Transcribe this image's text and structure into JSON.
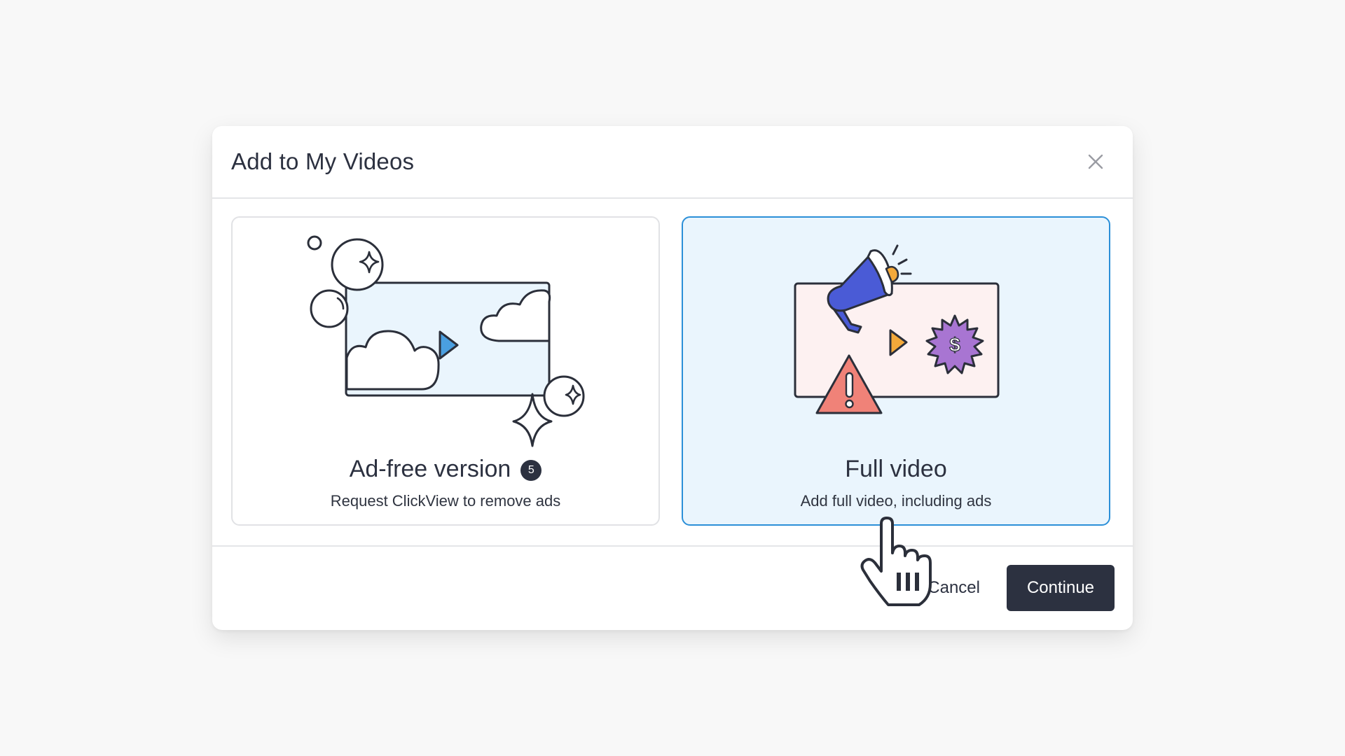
{
  "modal": {
    "title": "Add to My Videos",
    "close_icon": "close-icon"
  },
  "options": [
    {
      "id": "ad-free",
      "title": "Ad-free version",
      "badge": "5",
      "description": "Request ClickView to remove ads",
      "selected": false,
      "icon": "video-clouds-sparkles-icon"
    },
    {
      "id": "full",
      "title": "Full video",
      "description": "Add full video, including ads",
      "selected": true,
      "icon": "video-megaphone-ads-icon"
    }
  ],
  "footer": {
    "cancel_label": "Cancel",
    "continue_label": "Continue"
  },
  "colors": {
    "selected_border": "#2b8fd8",
    "selected_bg": "#eaf5fd",
    "primary_button": "#2c3140",
    "megaphone": "#4a5bd6",
    "warning": "#f08278",
    "badge_purple": "#a875d2",
    "play_blue": "#4a9fe0",
    "play_orange": "#f3a93a"
  },
  "cursor_icon": "hand-pointer-icon"
}
